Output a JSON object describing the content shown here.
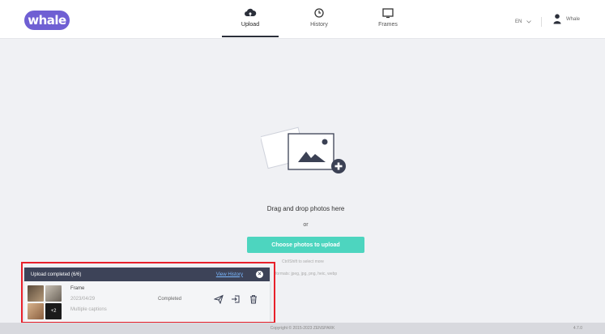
{
  "brand": {
    "logo_text": "whale",
    "accent": "#6f5fd3"
  },
  "nav": {
    "tabs": [
      {
        "label": "Upload",
        "icon": "cloud-upload-icon",
        "active": true
      },
      {
        "label": "History",
        "icon": "clock-icon",
        "active": false
      },
      {
        "label": "Frames",
        "icon": "monitor-icon",
        "active": false
      }
    ]
  },
  "header_right": {
    "language": "EN",
    "user_name": "Whale"
  },
  "dropzone": {
    "drag_text": "Drag and drop photos here",
    "or_text": "or",
    "choose_button": "Choose photos to upload",
    "choose_button_color": "#4dd5bf",
    "hint_select": "Ctrl/Shift to select more",
    "hint_formats": "formats: jpeg, jpg, png, heic, webp"
  },
  "upload_panel": {
    "title": "Upload completed (6/6)",
    "view_link": "View History",
    "item": {
      "name": "Frame",
      "date": "2023/04/29",
      "caption": "Multiple captions",
      "status": "Completed",
      "more_count": "+2"
    }
  },
  "footer": {
    "copyright": "Copyright © 2015-2023 ZENSPARK",
    "version": "4.7.0"
  }
}
